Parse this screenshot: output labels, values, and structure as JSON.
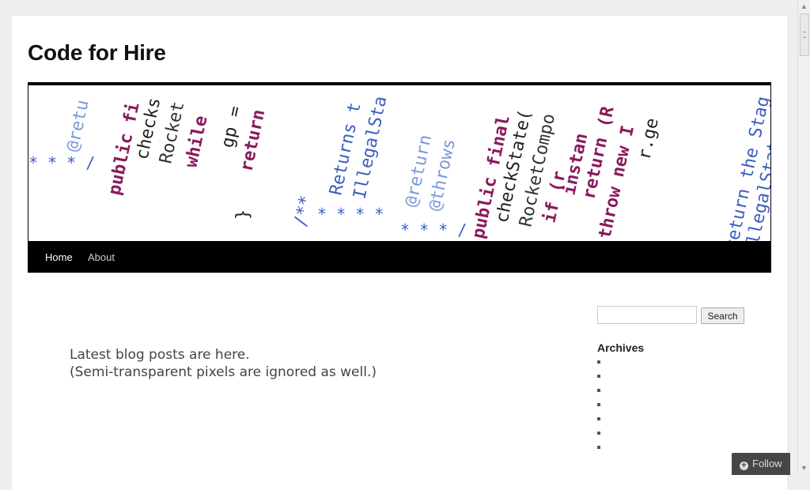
{
  "site": {
    "title": "Code for Hire"
  },
  "header_image": {
    "alt": "Code for Hire",
    "fragments": [
      "@retu",
      "public fi",
      "checks",
      "Rocket",
      "while",
      "gp =",
      "return",
      "/**",
      "Returns t",
      "IllegalSta",
      "@return",
      "@throws",
      "public final",
      "checkState(",
      "RocketCompo",
      "if (r",
      "instan",
      "return (R",
      "throw new I",
      "r.ge",
      "return the Stag",
      "IllegalStateEx",
      "}"
    ]
  },
  "nav": {
    "items": [
      {
        "label": "Home",
        "active": true
      },
      {
        "label": "About",
        "active": false
      }
    ]
  },
  "content": {
    "line1": "Latest blog posts are here.",
    "line2": "(Semi-transparent pixels are ignored as well.)"
  },
  "sidebar": {
    "search_placeholder": "",
    "search_button": "Search",
    "archives_title": "Archives",
    "archives_count": 7
  },
  "follow": {
    "label": "Follow",
    "icon": "plus-circle-icon"
  },
  "colors": {
    "magenta": "#8a1a5e",
    "blue": "#3b5fc0",
    "black": "#000000"
  }
}
